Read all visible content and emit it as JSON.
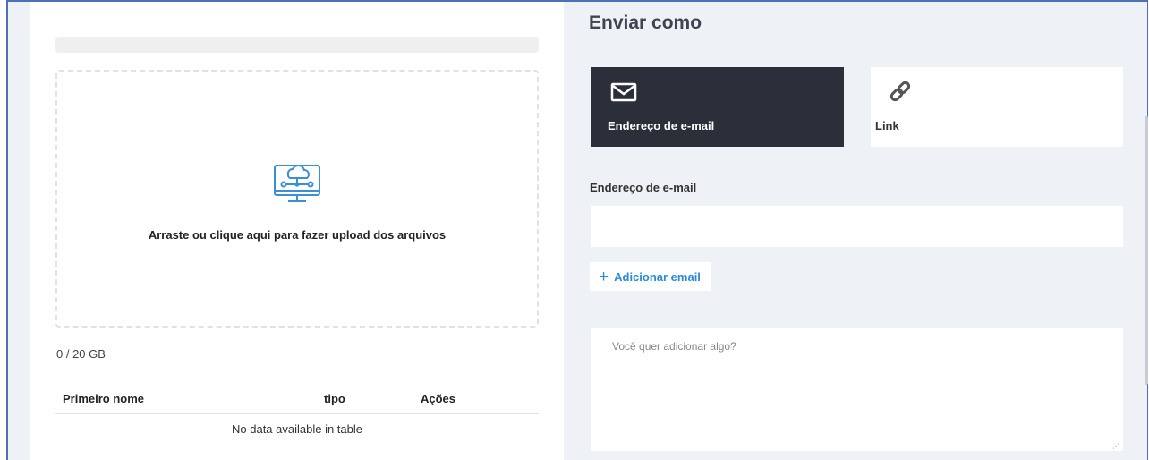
{
  "upload": {
    "progress_percent": 0,
    "dropzone_text": "Arraste ou clique aqui para fazer upload dos arquivos",
    "upload_icon": "cloud-computer-upload-icon",
    "storage_usage": "0 / 20 GB"
  },
  "files_table": {
    "columns": [
      "Primeiro nome",
      "tipo",
      "Ações"
    ],
    "empty_message": "No data available in table"
  },
  "send": {
    "title": "Enviar como",
    "options": [
      {
        "label": "Endereço de e-mail",
        "icon": "envelope-icon",
        "selected": true
      },
      {
        "label": "Link",
        "icon": "link-icon",
        "selected": false
      }
    ],
    "email_label": "Endereço de e-mail",
    "email_value": "",
    "add_email_label": "Adicionar email",
    "message_placeholder": "Você quer adicionar algo?"
  },
  "colors": {
    "selected_card_bg": "#2a2f3a",
    "accent_blue": "#2b8ad8",
    "panel_bg": "#eef1f6",
    "frame_border": "#4a72b5"
  }
}
